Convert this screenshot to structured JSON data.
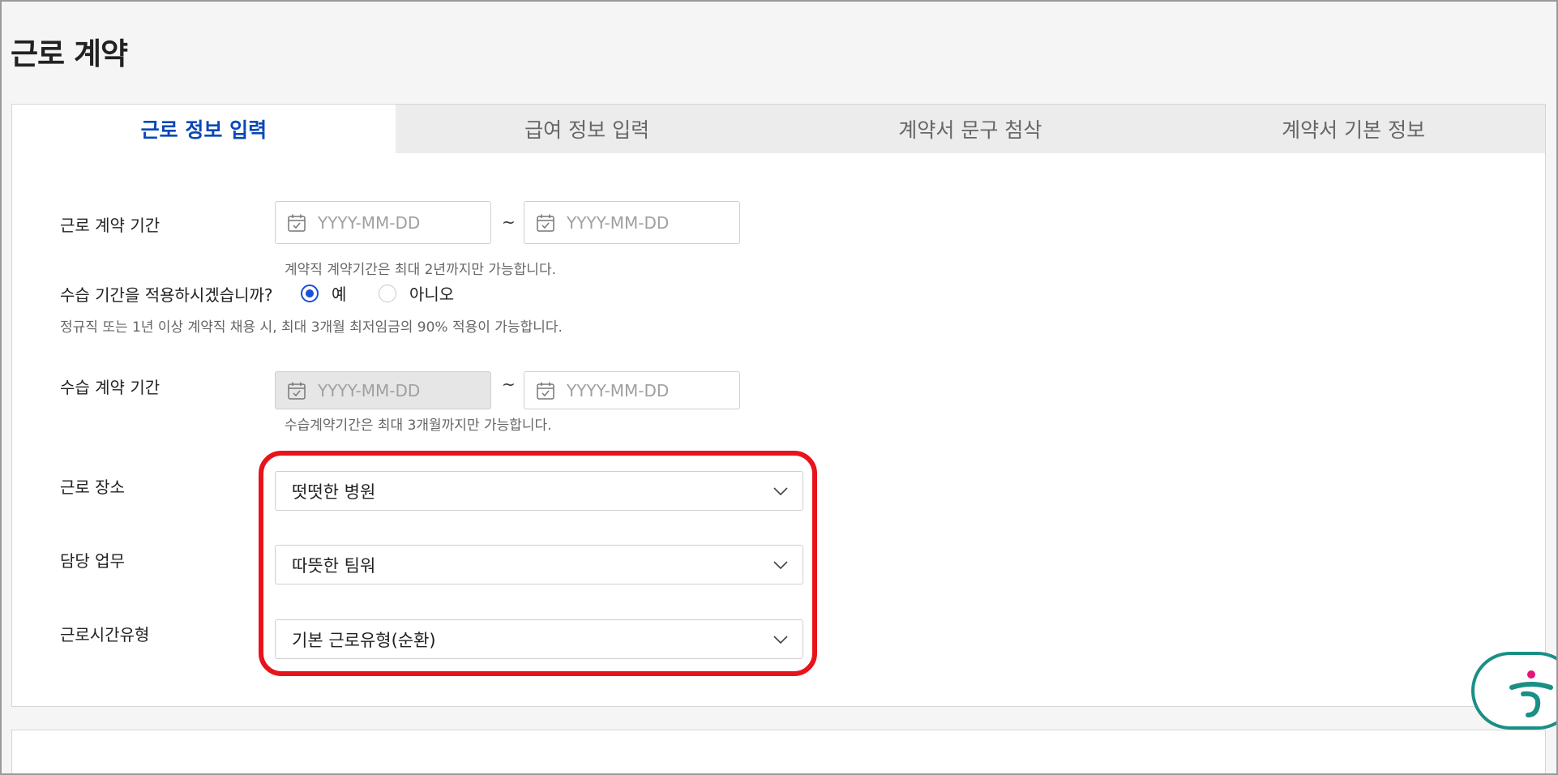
{
  "page": {
    "title": "근로 계약"
  },
  "tabs": [
    {
      "label": "근로 정보 입력",
      "active": true
    },
    {
      "label": "급여 정보 입력",
      "active": false
    },
    {
      "label": "계약서 문구 첨삭",
      "active": false
    },
    {
      "label": "계약서 기본 정보",
      "active": false
    }
  ],
  "contract_period": {
    "label": "근로 계약 기간",
    "start_placeholder": "YYYY-MM-DD",
    "end_placeholder": "YYYY-MM-DD",
    "separator": "~",
    "hint": "계약직 계약기간은 최대 2년까지만 가능합니다."
  },
  "probation": {
    "question": "수습 기간을 적용하시겠습니까?",
    "options": [
      {
        "label": "예",
        "selected": true
      },
      {
        "label": "아니오",
        "selected": false
      }
    ],
    "hint": "정규직 또는 1년 이상 계약직 채용 시, 최대 3개월 최저임금의 90% 적용이 가능합니다."
  },
  "probation_period": {
    "label": "수습 계약 기간",
    "start_placeholder": "YYYY-MM-DD",
    "end_placeholder": "YYYY-MM-DD",
    "separator": "~",
    "hint": "수습계약기간은 최대 3개월까지만 가능합니다."
  },
  "workplace": {
    "label": "근로 장소",
    "value": "떳떳한 병원"
  },
  "duty": {
    "label": "담당 업무",
    "value": "따뜻한 팀워"
  },
  "work_hours_type": {
    "label": "근로시간유형",
    "value": "기본 근로유형(순환)"
  },
  "colors": {
    "accent": "#0a48b7",
    "radio": "#1a4fd8",
    "highlight": "#e8141c",
    "brand": "#1a8f86"
  },
  "icons": {
    "calendar": "calendar-icon",
    "chevron": "chevron-down-icon",
    "assistant": "hana-logo-icon"
  }
}
